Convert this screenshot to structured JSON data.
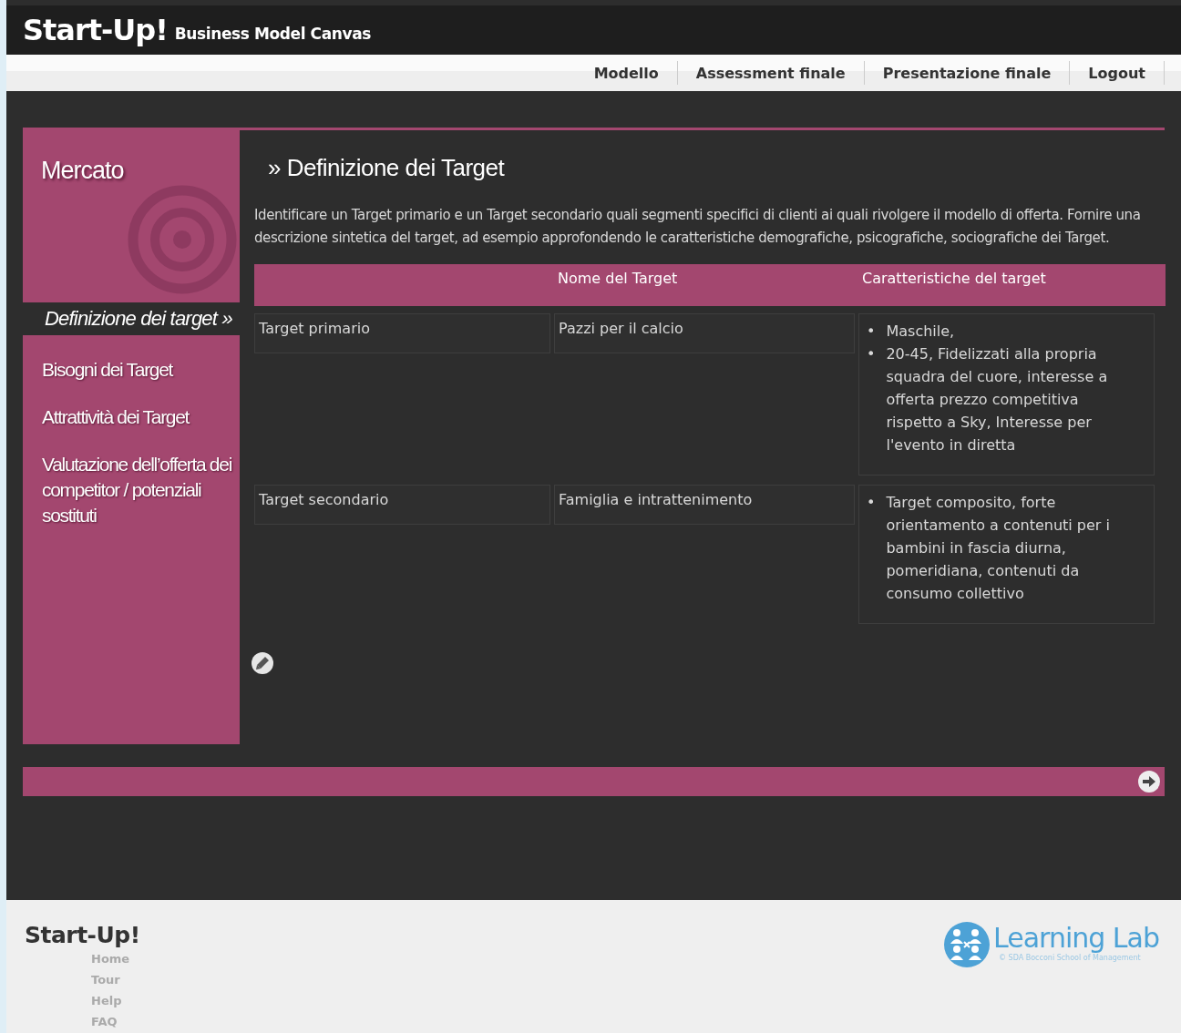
{
  "header": {
    "brand": "Start-Up!",
    "subtitle": "Business Model Canvas"
  },
  "nav": [
    {
      "label": "Modello"
    },
    {
      "label": "Assessment finale"
    },
    {
      "label": "Presentazione finale"
    },
    {
      "label": "Logout"
    }
  ],
  "sidebar": {
    "section": "Mercato",
    "items": [
      {
        "label": "Definizione dei target »",
        "selected": true
      },
      {
        "label": "Bisogni dei Target",
        "selected": false
      },
      {
        "label": "Attrattività dei Target",
        "selected": false
      },
      {
        "label": "Valutazione dell’offerta dei competitor / potenziali sostituti",
        "selected": false
      }
    ]
  },
  "content": {
    "title": "» Definizione dei Target",
    "description": "Identificare un Target primario e un Target secondario quali segmenti specifici di clienti ai quali rivolgere il modello di offerta. Fornire una descrizione sintetica del target, ad esempio approfondendo le caratteristiche demografiche, psicografiche, sociografiche dei Target.",
    "table": {
      "bullet": "•",
      "columns": [
        "Nome del Target",
        "Caratteristiche del target"
      ],
      "rows": [
        {
          "label": "Target primario",
          "name": "Pazzi per il calcio",
          "traits": [
            "Maschile,",
            "20-45, Fidelizzati alla propria squadra del cuore, interesse a offerta prezzo competitiva rispetto a Sky, Interesse per l'evento in diretta"
          ]
        },
        {
          "label": "Target secondario",
          "name": "Famiglia e intrattenimento",
          "traits": [
            "Target composito, forte orientamento a contenuti per i bambini in fascia diurna, pomeridiana, contenuti da consumo collettivo"
          ]
        }
      ]
    }
  },
  "footer": {
    "brand": "Start-Up!",
    "links": [
      "Home",
      "Tour",
      "Help",
      "FAQ"
    ],
    "partner": {
      "name": "Learning Lab",
      "tagline": "© SDA Bocconi School of Management"
    }
  }
}
